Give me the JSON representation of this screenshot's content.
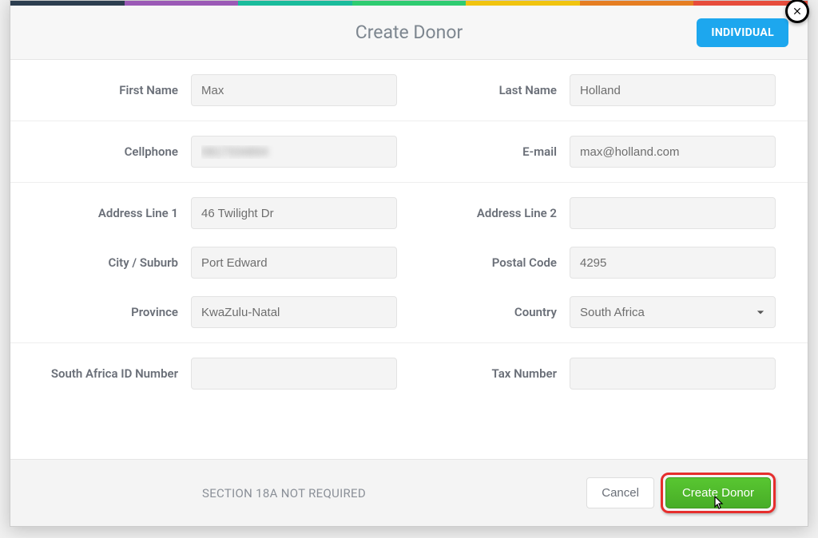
{
  "modal": {
    "title": "Create Donor",
    "badge": "INDIVIDUAL"
  },
  "form": {
    "firstName": {
      "label": "First Name",
      "value": "Max"
    },
    "lastName": {
      "label": "Last Name",
      "value": "Holland"
    },
    "cellphone": {
      "label": "Cellphone",
      "value": "0817334894"
    },
    "email": {
      "label": "E-mail",
      "value": "max@holland.com"
    },
    "address1": {
      "label": "Address Line 1",
      "value": "46 Twilight Dr"
    },
    "address2": {
      "label": "Address Line 2",
      "value": ""
    },
    "city": {
      "label": "City / Suburb",
      "value": "Port Edward"
    },
    "postal": {
      "label": "Postal Code",
      "value": "4295"
    },
    "province": {
      "label": "Province",
      "value": "KwaZulu-Natal"
    },
    "country": {
      "label": "Country",
      "selected": "South Africa"
    },
    "saId": {
      "label": "South Africa ID Number",
      "value": ""
    },
    "taxNo": {
      "label": "Tax Number",
      "value": ""
    }
  },
  "footer": {
    "note": "SECTION 18A NOT REQUIRED",
    "cancel": "Cancel",
    "submit": "Create Donor"
  }
}
